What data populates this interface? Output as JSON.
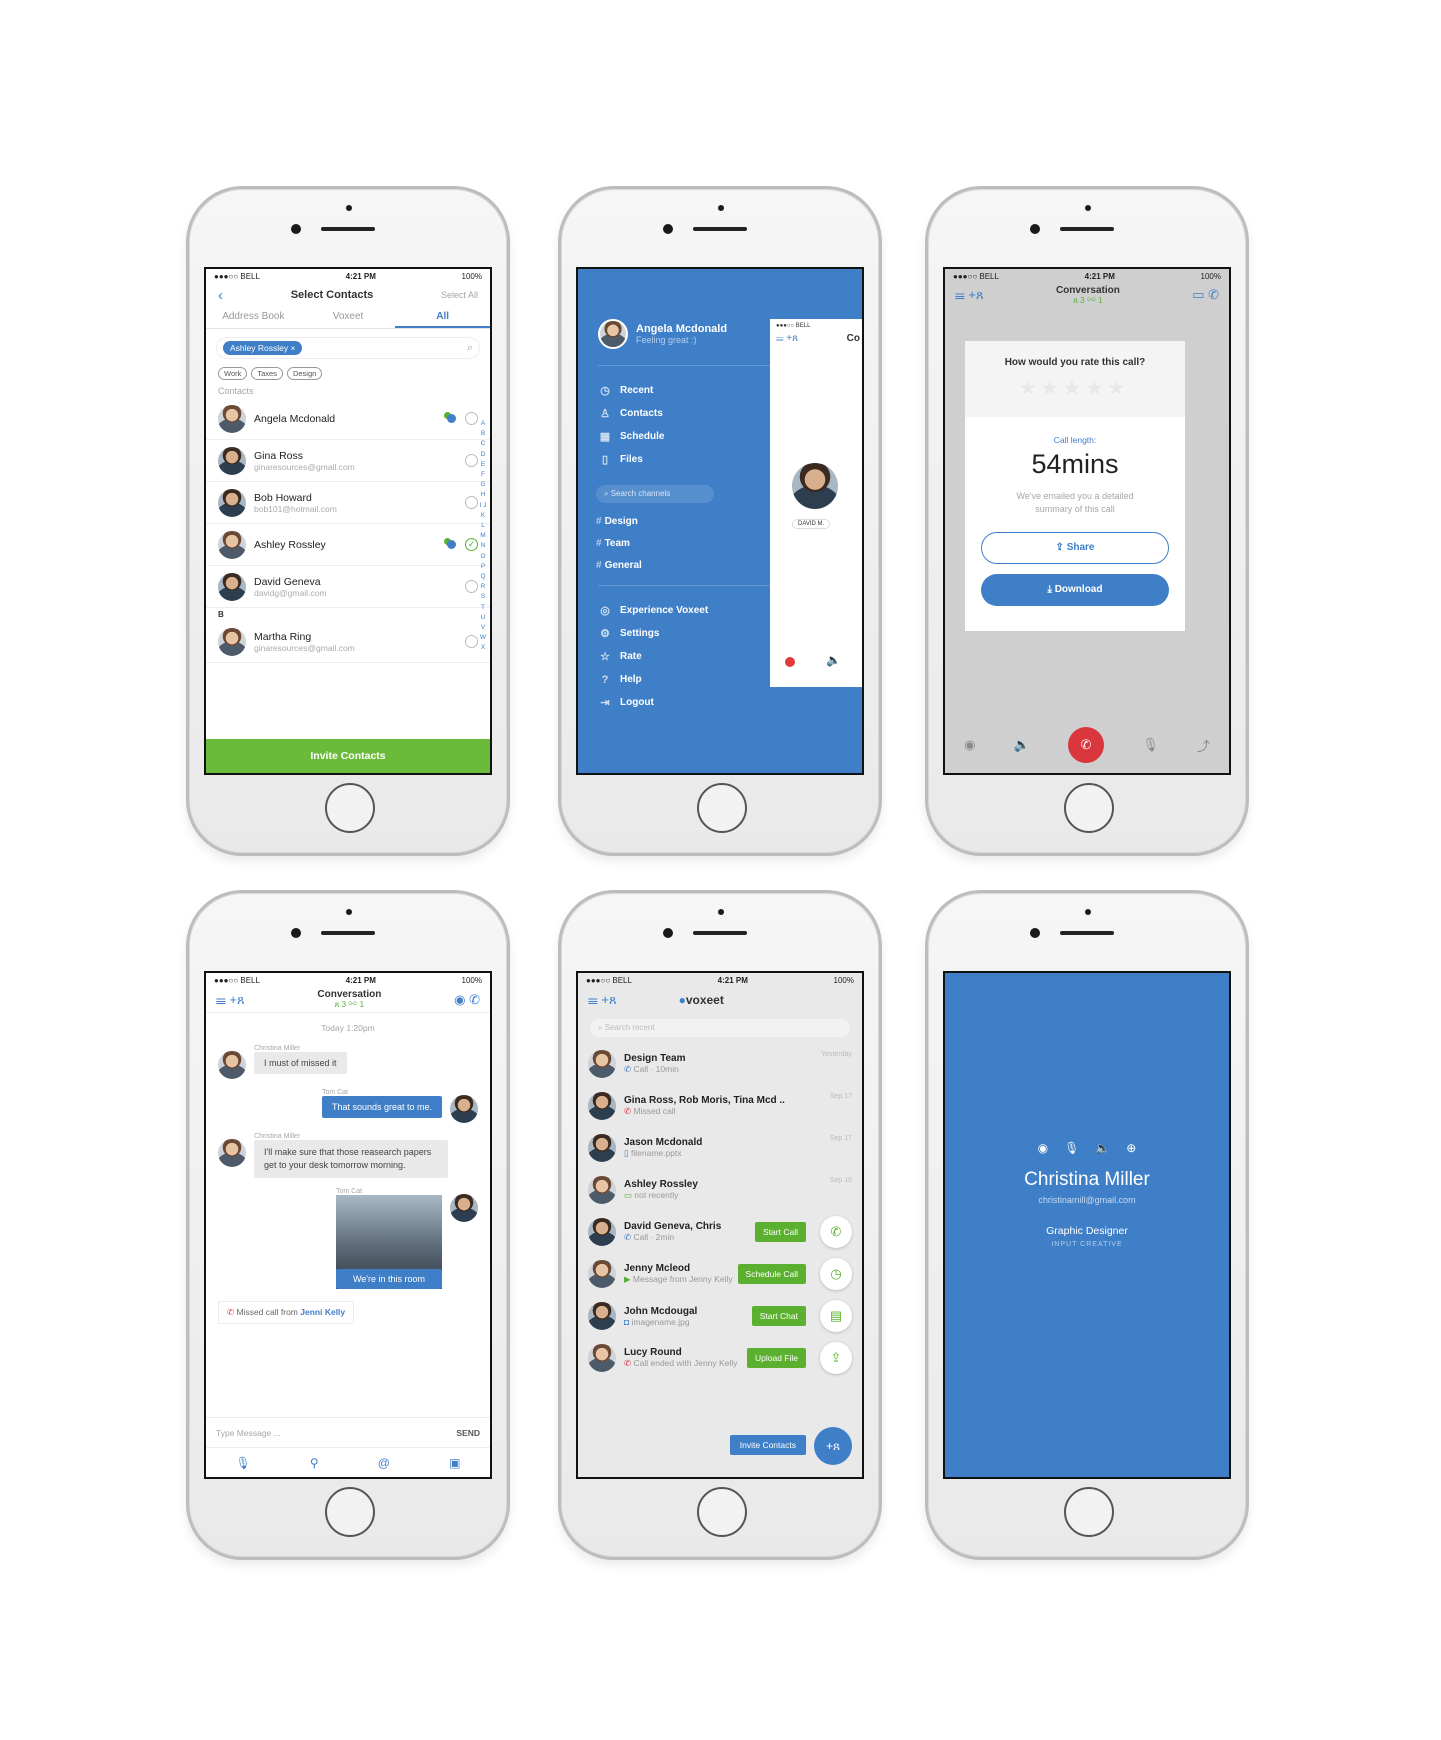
{
  "status": {
    "carrier": "●●●○○ BELL",
    "time": "4:21 PM",
    "battery": "100%"
  },
  "select_contacts": {
    "title": "Select Contacts",
    "select_all": "Select All",
    "tabs": [
      "Address Book",
      "Voxeet",
      "All"
    ],
    "chip": "Ashley Rossley ×",
    "tags": [
      "Work",
      "Taxes",
      "Design"
    ],
    "section": "Contacts",
    "section_b": "B",
    "contacts": [
      {
        "name": "Angela Mcdonald",
        "email": ""
      },
      {
        "name": "Gina Ross",
        "email": "ginaresources@gmail.com"
      },
      {
        "name": "Bob Howard",
        "email": "bob101@hotmail.com"
      },
      {
        "name": "Ashley Rossley",
        "email": ""
      },
      {
        "name": "David Geneva",
        "email": "davidg@gmail.com"
      },
      {
        "name": "Martha Ring",
        "email": "ginaresources@gmail.com"
      }
    ],
    "alphabet": "A B C D E F G H I J K L M N O P Q R S T U V W X",
    "invite": "Invite Contacts"
  },
  "menu": {
    "user": "Angela Mcdonald",
    "mood": "Feeling great :)",
    "items": [
      "Recent",
      "Contacts",
      "Schedule",
      "Files"
    ],
    "search_placeholder": "Search channels",
    "channels": [
      "Design",
      "Team",
      "General"
    ],
    "items2": [
      "Experience Voxeet",
      "Settings",
      "Rate",
      "Help",
      "Logout"
    ],
    "peek_status": "●●●○○ BELL",
    "peek_title": "Co",
    "peek_name": "DAVID M."
  },
  "rating": {
    "header_title": "Conversation",
    "header_counts": "ጸ 3  ⚯ 1",
    "question": "How would you rate this call?",
    "length_label": "Call length:",
    "length_value": "54mins",
    "note": "We've emailed you a detailed summary of this call",
    "share": "Share",
    "download": "Download"
  },
  "conversation": {
    "title": "Conversation",
    "counts": "ጸ 3  ⚯ 1",
    "date": "Today 1:20pm",
    "messages": [
      {
        "from": "Christina Miller",
        "text": "I must of missed it"
      },
      {
        "from": "Tom Cat",
        "text": "That sounds great to me."
      },
      {
        "from": "Christina Miller",
        "text": "I'll make sure that those reasearch papers get to your desk tomorrow morning."
      },
      {
        "from": "Tom Cat",
        "text": "We're in this room"
      }
    ],
    "missed_prefix": "Missed call from",
    "missed_name": "Jenni Kelly",
    "input_placeholder": "Type Message ...",
    "send": "SEND"
  },
  "recent": {
    "brand": "voxeet",
    "search_placeholder": "Search recent",
    "rows": [
      {
        "title": "Design Team",
        "sub": "Call · 10min",
        "date": "Yesterday"
      },
      {
        "title": "Gina Ross, Rob Moris, Tina Mcd ..",
        "sub": "Missed call",
        "date": "Sep 17"
      },
      {
        "title": "Jason Mcdonald",
        "sub": "filename.pptx",
        "date": "Sep 17"
      },
      {
        "title": "Ashley Rossley",
        "sub": "not recently",
        "date": "Sep 16"
      },
      {
        "title": "David Geneva, Chris",
        "sub": "Call · 2min",
        "date": ""
      },
      {
        "title": "Jenny Mcleod",
        "sub": "Message from Jenny Kelly",
        "date": ""
      },
      {
        "title": "John Mcdougal",
        "sub": "imagename.jpg",
        "date": ""
      },
      {
        "title": "Lucy Round",
        "sub": "Call ended with Jenny Kelly",
        "date": ""
      }
    ],
    "actions": [
      "Start Call",
      "Schedule Call",
      "Start Chat",
      "Upload File"
    ],
    "invite": "Invite Contacts"
  },
  "profile": {
    "name": "Christina Miller",
    "email": "christinamill@gmail.com",
    "role": "Graphic Designer",
    "company": "INPUT CREATIVE"
  }
}
